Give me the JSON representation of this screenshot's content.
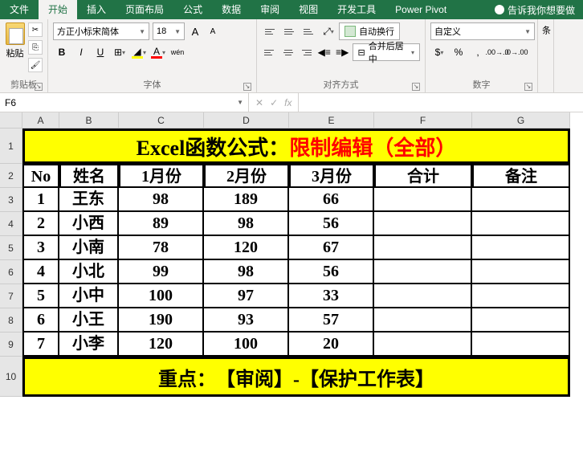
{
  "tabs": [
    "文件",
    "开始",
    "插入",
    "页面布局",
    "公式",
    "数据",
    "审阅",
    "视图",
    "开发工具",
    "Power Pivot"
  ],
  "active_tab": 1,
  "tell_me": "告诉我你想要做",
  "clipboard": {
    "paste": "粘贴",
    "label": "剪贴板"
  },
  "font": {
    "name": "方正小标宋简体",
    "size": "18",
    "grow": "A",
    "shrink": "A",
    "bold": "B",
    "italic": "I",
    "underline": "U",
    "label": "字体",
    "fill_letter": "",
    "font_letter": "A",
    "phonetic": "wén"
  },
  "align": {
    "wrap": "自动换行",
    "merge": "合并后居中",
    "label": "对齐方式"
  },
  "number": {
    "format": "自定义",
    "label": "数字"
  },
  "cond": "条",
  "name_box": "F6",
  "fx": "fx",
  "col_headers": [
    "A",
    "B",
    "C",
    "D",
    "E",
    "F",
    "G"
  ],
  "row_headers": [
    "1",
    "2",
    "3",
    "4",
    "5",
    "6",
    "7",
    "8",
    "9",
    "10"
  ],
  "banner": {
    "black": "Excel函数公式：",
    "red": "限制编辑（全部）"
  },
  "table_headers": [
    "No",
    "姓名",
    "1月份",
    "2月份",
    "3月份",
    "合计",
    "备注"
  ],
  "table_rows": [
    [
      "1",
      "王东",
      "98",
      "189",
      "66",
      "",
      ""
    ],
    [
      "2",
      "小西",
      "89",
      "98",
      "56",
      "",
      ""
    ],
    [
      "3",
      "小南",
      "78",
      "120",
      "67",
      "",
      ""
    ],
    [
      "4",
      "小北",
      "99",
      "98",
      "56",
      "",
      ""
    ],
    [
      "5",
      "小中",
      "100",
      "97",
      "33",
      "",
      ""
    ],
    [
      "6",
      "小王",
      "190",
      "93",
      "57",
      "",
      ""
    ],
    [
      "7",
      "小李",
      "120",
      "100",
      "20",
      "",
      ""
    ]
  ],
  "footer": {
    "black": "重点：",
    "red": "【审阅】-【保护工作表】"
  }
}
